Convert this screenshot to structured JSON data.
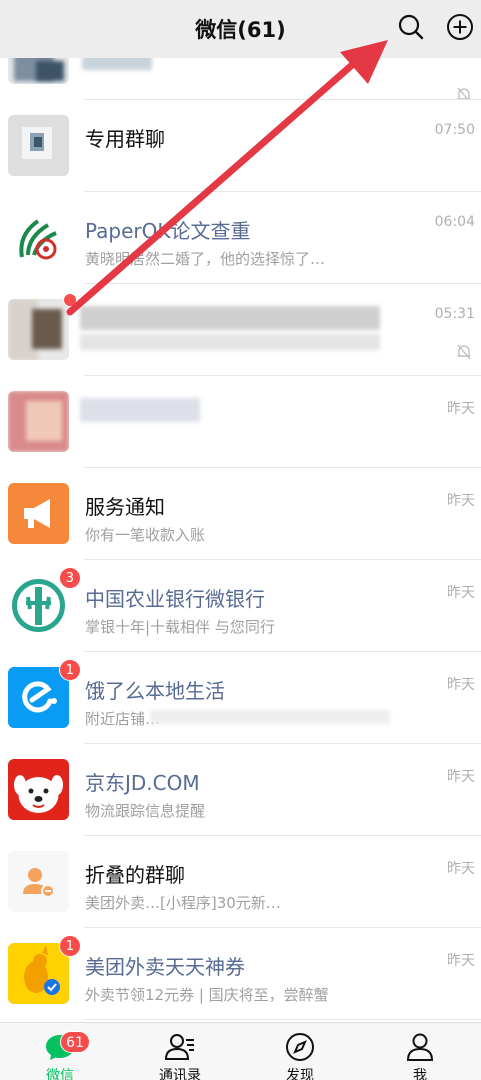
{
  "header": {
    "title": "微信(61)",
    "search_icon": "search-icon",
    "add_icon": "plus-circle-icon"
  },
  "chats": [
    {
      "name": "",
      "preview": "",
      "time": "",
      "muted": true,
      "avatar_icon": "blurred-avatar"
    },
    {
      "name": "专用群聊",
      "preview": "",
      "time": "07:50",
      "official": false,
      "avatar_icon": "group-avatar"
    },
    {
      "name": "PaperOK论文查重",
      "preview": "黄晓明居然二婚了，他的选择惊了…",
      "time": "06:04",
      "official": true,
      "avatar_icon": "paperok-logo"
    },
    {
      "name": "",
      "preview": "",
      "time": "05:31",
      "muted": true,
      "badge": "",
      "avatar_icon": "blurred-avatar"
    },
    {
      "name": "",
      "preview": "",
      "time": "昨天",
      "avatar_icon": "blurred-avatar"
    },
    {
      "name": "服务通知",
      "preview": "你有一笔收款入账",
      "time": "昨天",
      "official": false,
      "avatar_icon": "megaphone-icon"
    },
    {
      "name": "中国农业银行微银行",
      "preview": "掌银十年|十载相伴 与您同行",
      "time": "昨天",
      "official": true,
      "badge": "3",
      "avatar_icon": "abc-bank-logo"
    },
    {
      "name": "饿了么本地生活",
      "preview": "附近店铺…",
      "time": "昨天",
      "official": true,
      "badge": "1",
      "avatar_icon": "eleme-logo"
    },
    {
      "name": "京东JD.COM",
      "preview": "物流跟踪信息提醒",
      "time": "昨天",
      "official": true,
      "avatar_icon": "jd-dog-logo"
    },
    {
      "name": "折叠的群聊",
      "preview": "美团外卖…[小程序]30元新…",
      "time": "昨天",
      "official": false,
      "avatar_icon": "folded-group-icon"
    },
    {
      "name": "美团外卖天天神券",
      "preview": "外卖节领12元券 | 国庆将至，尝醉蟹",
      "time": "昨天",
      "official": true,
      "badge": "1",
      "avatar_icon": "meituan-kangaroo-logo"
    }
  ],
  "tabbar": {
    "tabs": [
      {
        "label": "微信",
        "icon": "chat-bubble-icon",
        "badge": "61",
        "active": true
      },
      {
        "label": "通讯录",
        "icon": "contacts-icon"
      },
      {
        "label": "发现",
        "icon": "compass-icon"
      },
      {
        "label": "我",
        "icon": "person-icon"
      }
    ]
  },
  "colors": {
    "header_bg": "#ededed",
    "accent_green": "#07c160",
    "badge_red": "#f74c4c",
    "official_name": "#576b95",
    "annotation_arrow": "#e53845"
  }
}
